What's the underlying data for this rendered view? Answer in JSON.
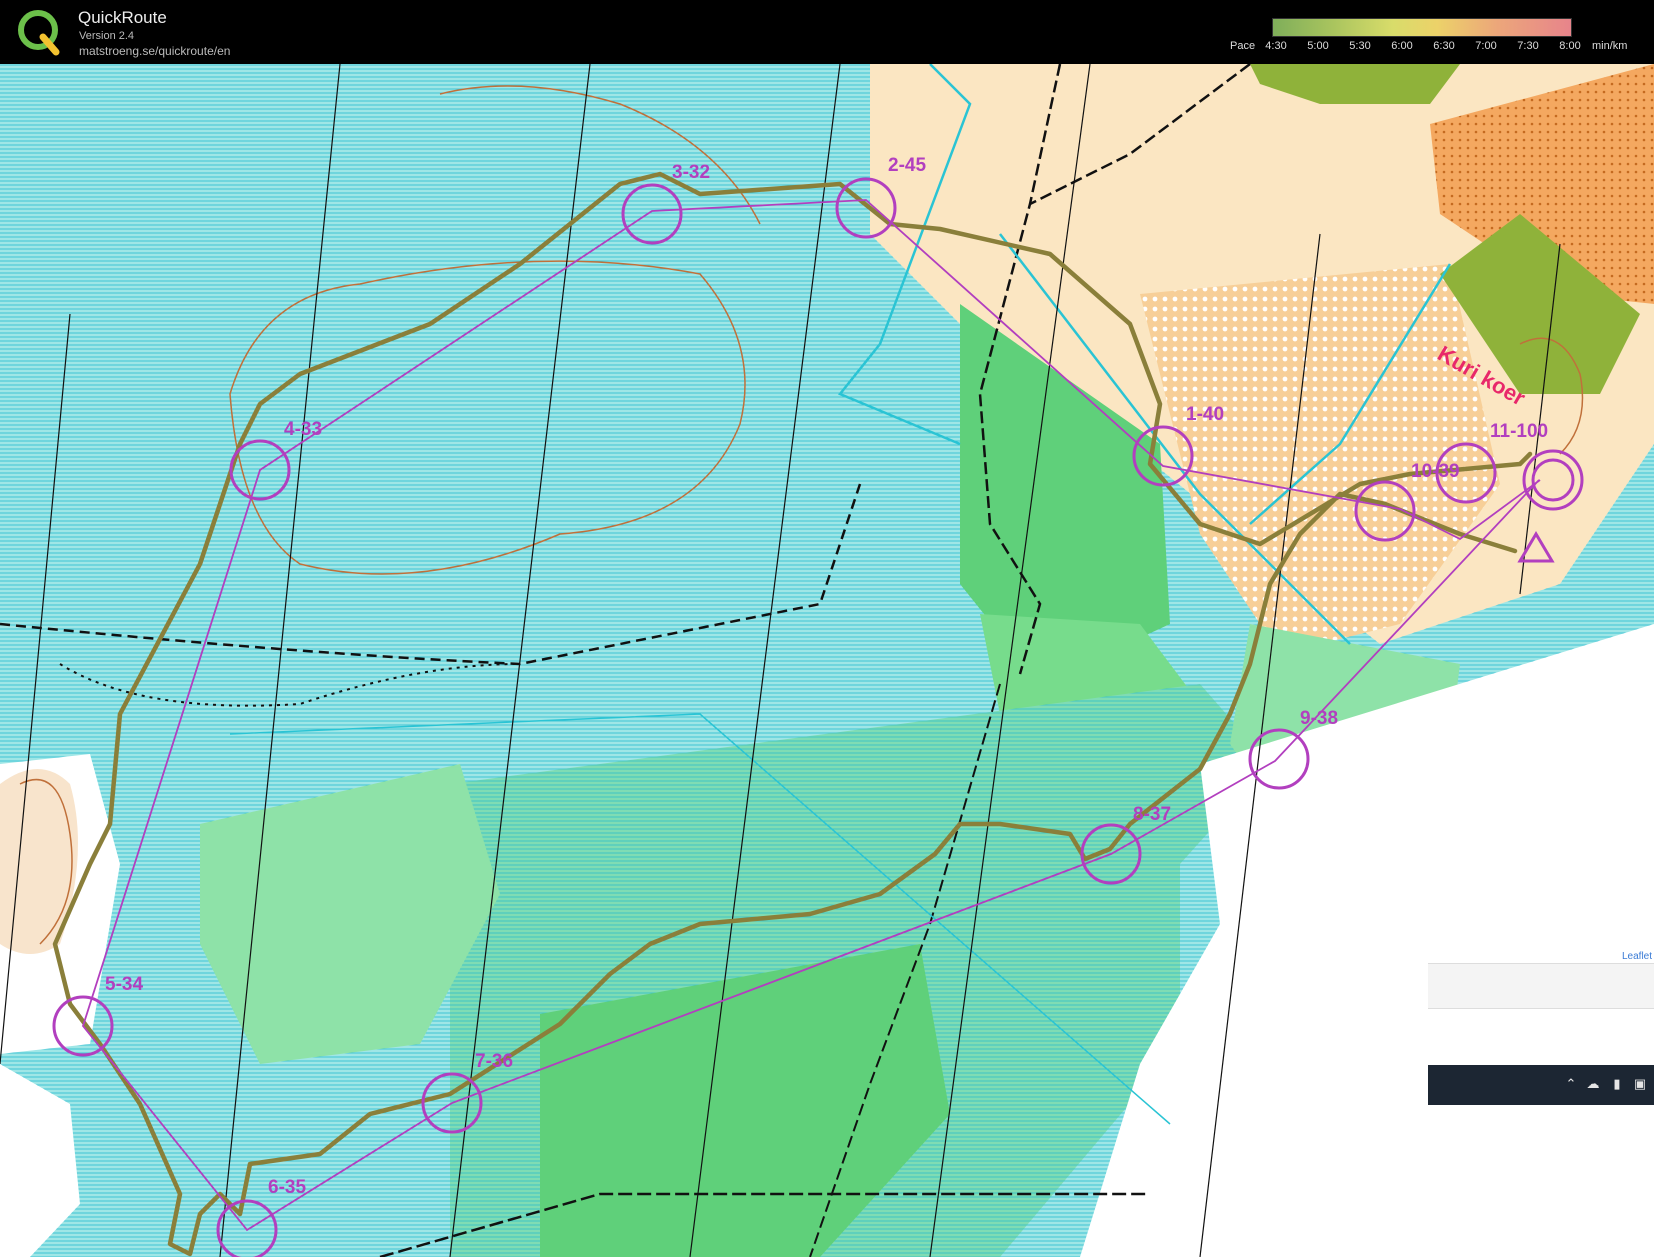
{
  "app": {
    "title": "QuickRoute",
    "version": "Version 2.4",
    "url": "matstroeng.se/quickroute/en",
    "logo_letter": "Q"
  },
  "pace_legend": {
    "label": "Pace",
    "ticks": [
      "4:30",
      "5:00",
      "5:30",
      "6:00",
      "6:30",
      "7:00",
      "7:30",
      "8:00"
    ],
    "unit": "min/km",
    "color_fast": "#7fae5a",
    "color_slow": "#e7848b"
  },
  "map": {
    "area_label": "Kuri koer",
    "control_color": "#b23fbf",
    "route_color": "#8a7f3a",
    "controls": [
      {
        "id": "1",
        "label": "1-40"
      },
      {
        "id": "2",
        "label": "2-45"
      },
      {
        "id": "3",
        "label": "3-32"
      },
      {
        "id": "4",
        "label": "4-33"
      },
      {
        "id": "5",
        "label": "5-34"
      },
      {
        "id": "6",
        "label": "6-35"
      },
      {
        "id": "7",
        "label": "7-36"
      },
      {
        "id": "8",
        "label": "8-37"
      },
      {
        "id": "9",
        "label": "9-38"
      },
      {
        "id": "10",
        "label": "10-39"
      },
      {
        "id": "11",
        "label": "11-100"
      }
    ],
    "attribution": "Leaflet"
  },
  "taskbar": {
    "icons": [
      "chevron-up-icon",
      "cloud-icon",
      "battery-icon",
      "monitor-icon"
    ]
  }
}
